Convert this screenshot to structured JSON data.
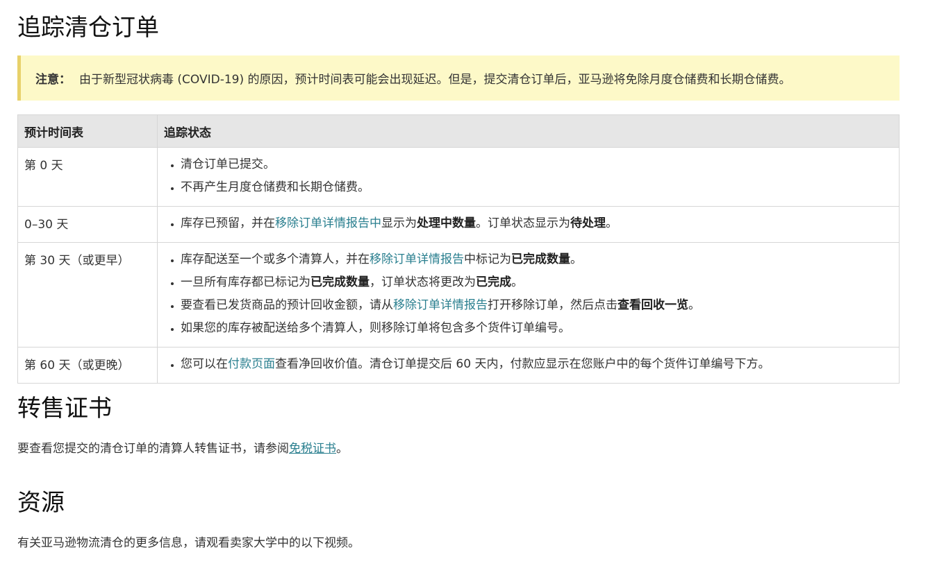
{
  "page_title": "追踪清仓订单",
  "notice": {
    "label": "注意：",
    "text": "由于新型冠状病毒 (COVID-19) 的原因，预计时间表可能会出现延迟。但是，提交清仓订单后，亚马逊将免除月度仓储费和长期仓储费。"
  },
  "table": {
    "headers": [
      "预计时间表",
      "追踪状态"
    ],
    "rows": [
      {
        "timeline": "第 0 天",
        "items": [
          {
            "t1": "清仓订单已提交。"
          },
          {
            "t1": "不再产生月度仓储费和长期仓储费。"
          }
        ]
      },
      {
        "timeline": "0–30 天",
        "items": [
          {
            "t1": "库存已预留，并在",
            "link": "移除订单详情报告中",
            "t2": "显示为",
            "b1": "处理中数量",
            "t3": "。订单状态显示为",
            "b2": "待处理",
            "t4": "。"
          }
        ]
      },
      {
        "timeline": "第 30 天（或更早）",
        "items": [
          {
            "t1": "库存配送至一个或多个清算人，并在",
            "link": "移除订单详情报告",
            "t2": "中标记为",
            "b1": "已完成数量",
            "t3": "。"
          },
          {
            "t1": "一旦所有库存都已标记为",
            "b1": "已完成数量",
            "t2": "，订单状态将更改为",
            "b2": "已完成",
            "t3": "。"
          },
          {
            "t1": "要查看已发货商品的预计回收金额，请从",
            "link": "移除订单详情报告",
            "t2": "打开移除订单，然后点击",
            "b1": "查看回收一览",
            "t3": "。"
          },
          {
            "t1": "如果您的库存被配送给多个清算人，则移除订单将包含多个货件订单编号。"
          }
        ]
      },
      {
        "timeline": "第 60 天（或更晚）",
        "items": [
          {
            "t1": "您可以在",
            "link": "付款页面",
            "t2": "查看净回收价值。清仓订单提交后 60 天内，付款应显示在您账户中的每个货件订单编号下方。"
          }
        ]
      }
    ]
  },
  "resale": {
    "heading": "转售证书",
    "text_before": "要查看您提交的清仓订单的清算人转售证书，请参阅",
    "link": "免税证书",
    "text_after": "。"
  },
  "resources": {
    "heading": "资源",
    "text": "有关亚马逊物流清仓的更多信息，请观看卖家大学中的以下视频。"
  },
  "colors": {
    "link": "#2a7f8f",
    "notice_bg": "#fdf9c8",
    "notice_border": "#e8d16a",
    "header_bg": "#e6e6e6"
  }
}
